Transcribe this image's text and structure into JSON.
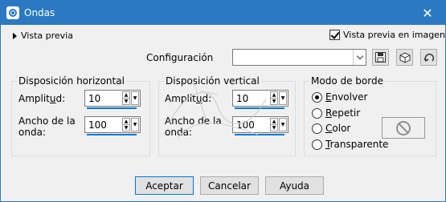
{
  "window": {
    "title": "Ondas",
    "close_glyph": "✕"
  },
  "preview": {
    "toggle_label": "Vista previa",
    "image_preview_label": "Vista previa en imagen",
    "image_preview_checked": true
  },
  "config": {
    "label": "Configuración",
    "value": ""
  },
  "toolbar_icons": [
    "save-icon",
    "cube-icon",
    "reset-icon"
  ],
  "horizontal": {
    "title": "Disposición horizontal",
    "amplitude_label_pre": "Amplit",
    "amplitude_label_ul": "u",
    "amplitude_label_post": "d:",
    "amplitude_value": "10",
    "wavelength_label_1": "Ancho de la",
    "wavelength_label_2": "onda:",
    "wavelength_value": "100"
  },
  "vertical": {
    "title": "Disposición vertical",
    "amplitude_label_pre": "Amplit",
    "amplitude_label_ul": "u",
    "amplitude_label_post": "d:",
    "amplitude_value": "10",
    "wavelength_label_1": "Ancho de la",
    "wavelength_label_2": "onda:",
    "wavelength_value": "100"
  },
  "border_mode": {
    "title": "Modo de borde",
    "options": [
      {
        "ul": "E",
        "rest": "nvolver",
        "selected": true
      },
      {
        "ul": "R",
        "rest": "epetir",
        "selected": false
      },
      {
        "ul": "C",
        "rest": "olor",
        "selected": false
      },
      {
        "ul": "T",
        "rest": "ransparente",
        "selected": false
      }
    ]
  },
  "buttons": {
    "ok": "Aceptar",
    "cancel": "Cancelar",
    "help": "Ayuda"
  },
  "colors": {
    "titlebar": "#2b79c2",
    "accent": "#0078d7"
  }
}
